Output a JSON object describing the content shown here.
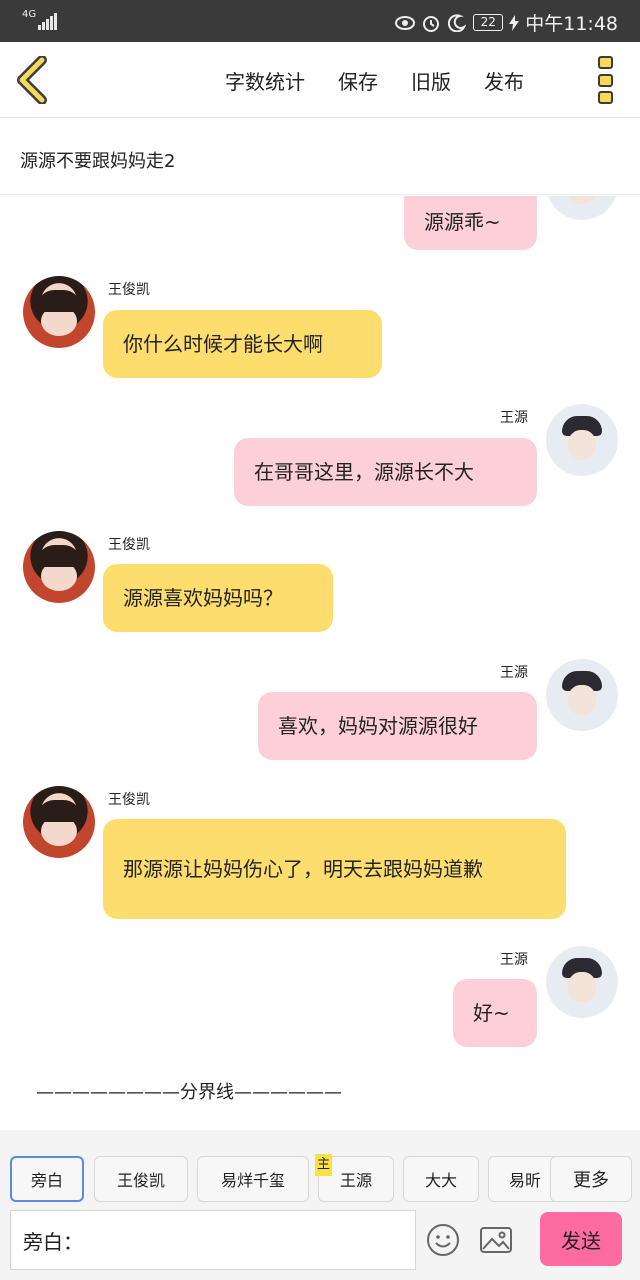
{
  "status_bar": {
    "network": "4G",
    "alarm_icon": "alarm-icon",
    "battery": "22",
    "time": "中午11:48"
  },
  "header": {
    "actions": [
      "字数统计",
      "保存",
      "旧版",
      "发布"
    ]
  },
  "story_title": "源源不要跟妈妈走2",
  "messages": [
    {
      "speaker": "",
      "side": "right",
      "text": "源源乖~"
    },
    {
      "speaker": "王俊凯",
      "side": "left",
      "text": "你什么时候才能长大啊"
    },
    {
      "speaker": "王源",
      "side": "right",
      "text": "在哥哥这里，源源长不大"
    },
    {
      "speaker": "王俊凯",
      "side": "left",
      "text": "源源喜欢妈妈吗？"
    },
    {
      "speaker": "王源",
      "side": "right",
      "text": "喜欢，妈妈对源源很好"
    },
    {
      "speaker": "王俊凯",
      "side": "left",
      "text": "那源源让妈妈伤心了，明天去跟妈妈道歉"
    },
    {
      "speaker": "王源",
      "side": "right",
      "text": "好~"
    }
  ],
  "divider_text": "————————分界线——————",
  "roles": [
    "旁白",
    "王俊凯",
    "易烊千玺",
    "王源",
    "大大",
    "易昕"
  ],
  "main_tag": "主",
  "more_label": "更多",
  "input": {
    "value": "旁白："
  },
  "send_label": "发送",
  "colors": {
    "left_bubble": "#fedd6f",
    "right_bubble": "#fdd0d9",
    "send": "#fe6ba0",
    "back_icon": "#f9d85a"
  }
}
